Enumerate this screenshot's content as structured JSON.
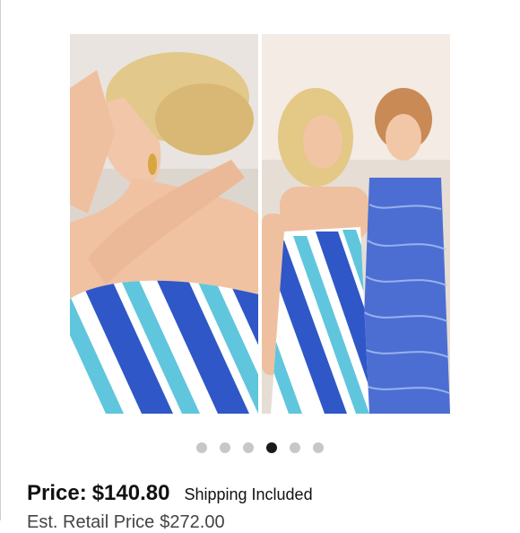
{
  "listing": {
    "images": [
      {
        "name": "model-hair-closeup"
      },
      {
        "name": "two-models-beach"
      }
    ],
    "carousel": {
      "total": 6,
      "active_index": 3
    },
    "price_label": "Price:",
    "price_value": "$140.80",
    "shipping_text": "Shipping Included",
    "retail_label": "Est. Retail Price",
    "retail_value": "$272.00"
  },
  "colors": {
    "stripe_blue": "#2f57c7",
    "stripe_aqua": "#5fc6dd",
    "dot_inactive": "#c7c7c7",
    "dot_active": "#1a1a1a"
  }
}
